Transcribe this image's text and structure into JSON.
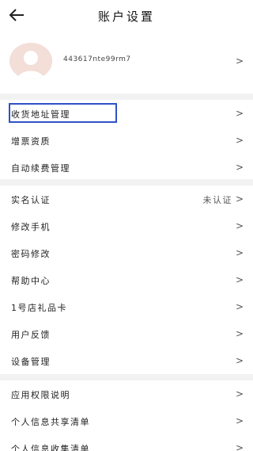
{
  "header": {
    "title": "账户设置",
    "back_icon": "arrow-left-icon"
  },
  "profile": {
    "username": "443617nte99rm7",
    "avatar_icon": "default-avatar-icon"
  },
  "group1": [
    {
      "label": "收货地址管理"
    },
    {
      "label": "增票资质"
    },
    {
      "label": "自动续费管理"
    }
  ],
  "group2": [
    {
      "label": "实名认证",
      "status": "未认证"
    },
    {
      "label": "修改手机"
    },
    {
      "label": "密码修改"
    },
    {
      "label": "帮助中心"
    },
    {
      "label": "1号店礼品卡"
    },
    {
      "label": "用户反馈"
    },
    {
      "label": "设备管理"
    }
  ],
  "group3": [
    {
      "label": "应用权限说明"
    },
    {
      "label": "个人信息共享清单"
    },
    {
      "label": "个人信息收集清单"
    }
  ],
  "chevron": ">",
  "colors": {
    "highlight": "#2f52c6",
    "divider": "#f2f2f2"
  }
}
